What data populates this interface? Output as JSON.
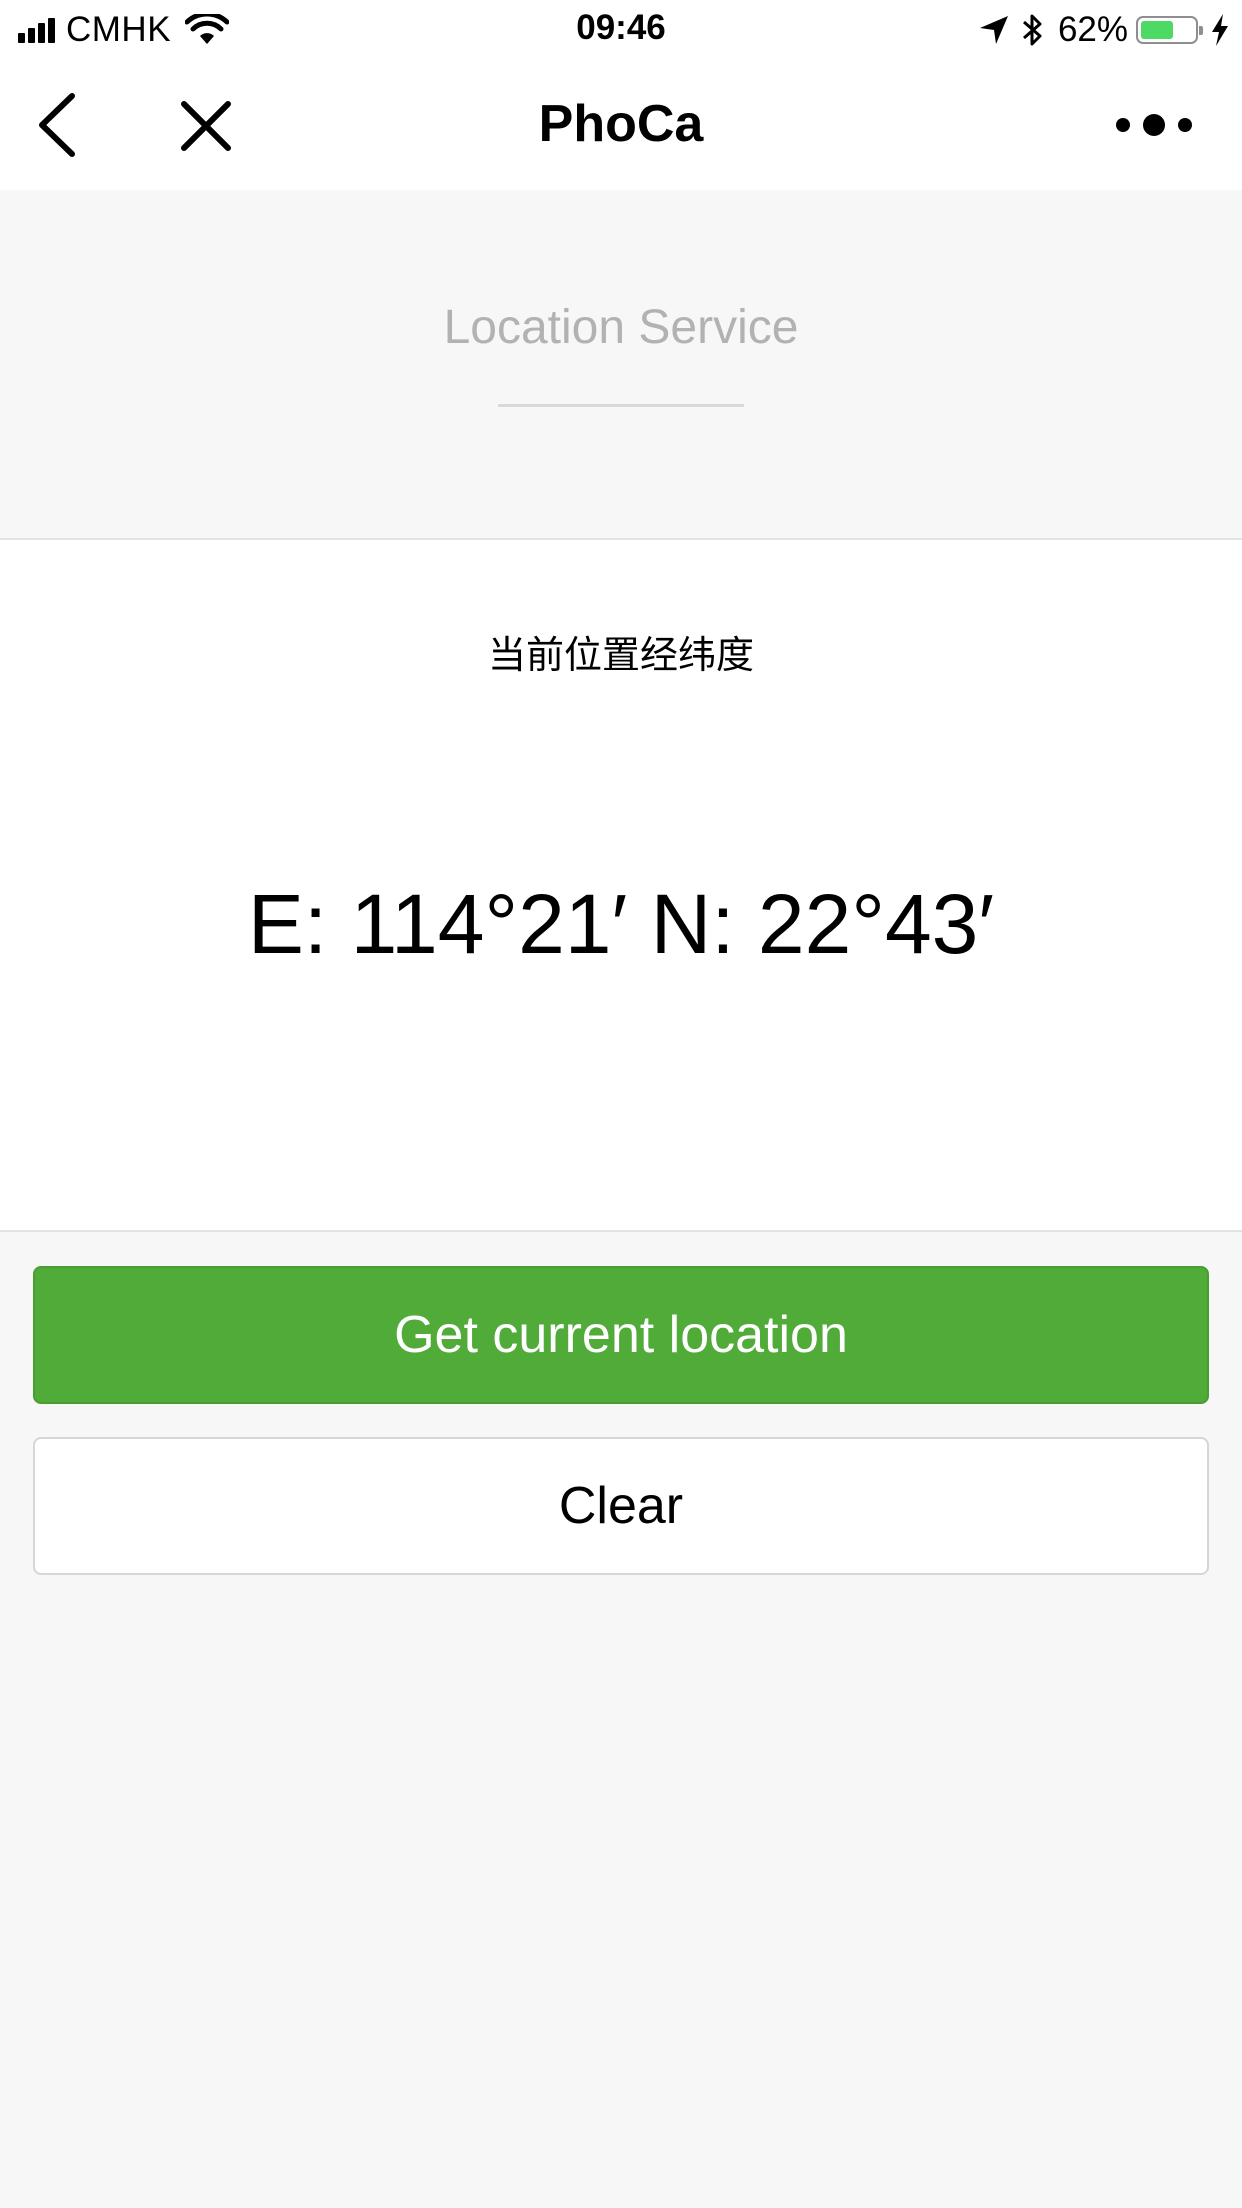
{
  "status_bar": {
    "carrier": "CMHK",
    "time": "09:46",
    "battery_percent": "62%",
    "battery_level": 0.62,
    "icons": [
      "signal-icon",
      "wifi-icon",
      "location-arrow-icon",
      "bluetooth-icon",
      "battery-icon",
      "charging-icon"
    ],
    "battery_color": "#4cd964"
  },
  "nav": {
    "title": "PhoCa",
    "icons": [
      "back-icon",
      "close-icon",
      "more-icon"
    ]
  },
  "header": {
    "title": "Location Service"
  },
  "content": {
    "label": "当前位置经纬度",
    "coordinates": "E: 114°21′ N: 22°43′"
  },
  "buttons": {
    "primary_label": "Get current location",
    "secondary_label": "Clear"
  },
  "colors": {
    "primary": "#51ab38",
    "background": "#f7f7f7",
    "card": "#ffffff"
  }
}
